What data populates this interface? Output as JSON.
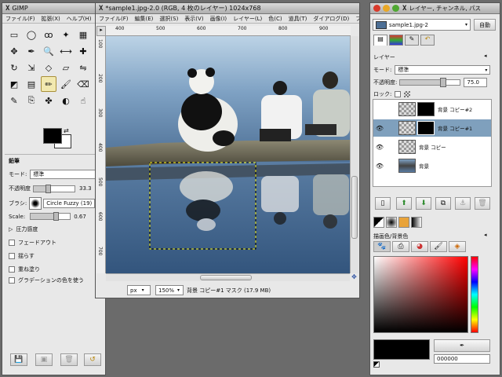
{
  "toolbox": {
    "title": "GIMP",
    "menu": [
      "ファイル(F)",
      "拡張(X)",
      "ヘルプ(H)"
    ],
    "tools": [
      {
        "icon": "▭",
        "name": "rect-select-icon"
      },
      {
        "icon": "◯",
        "name": "ellipse-select-icon"
      },
      {
        "icon": "ꝏ",
        "name": "free-select-icon"
      },
      {
        "icon": "✦",
        "name": "fuzzy-select-icon"
      },
      {
        "icon": "▦",
        "name": "color-select-icon"
      },
      {
        "icon": "✂",
        "name": "scissors-icon"
      },
      {
        "icon": "✥",
        "name": "paths-icon"
      },
      {
        "icon": "✒",
        "name": "color-picker-icon"
      },
      {
        "icon": "🔍",
        "name": "zoom-icon"
      },
      {
        "icon": "⟷",
        "name": "measure-icon"
      },
      {
        "icon": "✚",
        "name": "move-icon"
      },
      {
        "icon": "⬚",
        "name": "crop-icon"
      },
      {
        "icon": "↻",
        "name": "rotate-icon"
      },
      {
        "icon": "⇲",
        "name": "scale-icon"
      },
      {
        "icon": "◇",
        "name": "shear-icon"
      },
      {
        "icon": "▱",
        "name": "perspective-icon"
      },
      {
        "icon": "⇋",
        "name": "flip-icon"
      },
      {
        "icon": "A",
        "name": "text-icon"
      },
      {
        "icon": "◩",
        "name": "bucket-fill-icon"
      },
      {
        "icon": "▤",
        "name": "blend-icon"
      },
      {
        "icon": "✏",
        "name": "pencil-icon"
      },
      {
        "icon": "🖌",
        "name": "paintbrush-icon"
      },
      {
        "icon": "⌫",
        "name": "eraser-icon"
      },
      {
        "icon": "✈",
        "name": "airbrush-icon"
      },
      {
        "icon": "✎",
        "name": "ink-icon"
      },
      {
        "icon": "⎘",
        "name": "clone-icon"
      },
      {
        "icon": "✤",
        "name": "heal-icon"
      },
      {
        "icon": "◐",
        "name": "dodge-burn-icon"
      },
      {
        "icon": "☝",
        "name": "smudge-icon"
      },
      {
        "icon": "◉",
        "name": "convolve-icon"
      }
    ],
    "options": {
      "section": "鉛筆",
      "mode_label": "モード:",
      "mode_value": "標準",
      "opacity_label": "不透明度",
      "opacity_value": "33.3",
      "opacity_fraction": 0.333,
      "brush_label": "ブラシ:",
      "brush_value": "Circle Fuzzy (19)",
      "scale_label": "Scale:",
      "scale_value": "0.67",
      "scale_fraction": 0.67,
      "pressure": "圧力感度",
      "fadeout": "フェードアウト",
      "jitter": "揺らす",
      "incremental": "重ね塗り",
      "gradient": "グラデーションの色を使う"
    }
  },
  "image_window": {
    "title": "*sample1.jpg-2.0 (RGB, 4 枚のレイヤー) 1024x768",
    "menu": [
      "ファイル(F)",
      "編集(E)",
      "選択(S)",
      "表示(V)",
      "画像(I)",
      "レイヤー(L)",
      "色(C)",
      "道具(T)",
      "ダイアログ(D)",
      "フィルタ(R)"
    ],
    "ruler_h": [
      "400",
      "500",
      "600",
      "700",
      "800",
      "900"
    ],
    "ruler_v": [
      "100",
      "200",
      "300",
      "400",
      "500",
      "600",
      "700"
    ],
    "unit": "px",
    "zoom": "150%",
    "status": "背景 コピー#1 マスク (17.9 MB)"
  },
  "layers": {
    "title": "レイヤー, チャンネル, パス",
    "image_select": "sample1.jpg-2",
    "auto_label": "自動",
    "panel_title": "レイヤー",
    "mode_label": "モード:",
    "mode_value": "標準",
    "opacity_label": "不透明度:",
    "opacity_value": "75.0",
    "opacity_fraction": 0.75,
    "lock_label": "ロック:",
    "items": [
      {
        "name": "背景 コピー#2",
        "eye": "",
        "mask": true,
        "selected": false
      },
      {
        "name": "背景 コピー#1",
        "eye": "👁",
        "mask": true,
        "selected": true
      },
      {
        "name": "背景 コピー",
        "eye": "👁",
        "mask": false,
        "selected": false
      },
      {
        "name": "背景",
        "eye": "👁",
        "mask": false,
        "selected": false
      }
    ]
  },
  "colors": {
    "panel_title": "描画色/背景色",
    "hex_value": "000000"
  }
}
